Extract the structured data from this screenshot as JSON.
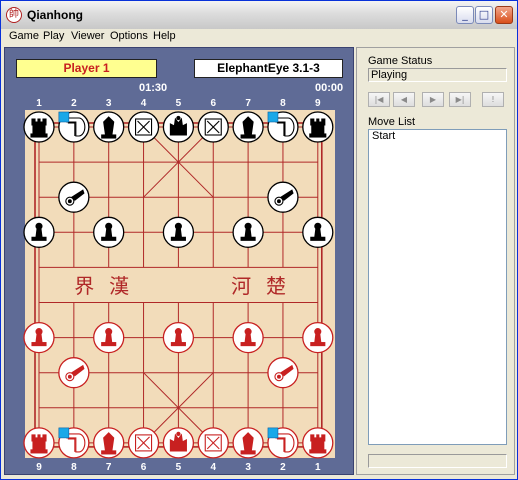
{
  "window": {
    "title": "Qianhong",
    "icon": "qianhong-app-icon",
    "icon_glyph": "帥",
    "controls": [
      "minimize-icon",
      "maximize-icon",
      "close-icon"
    ]
  },
  "menu": [
    "Game",
    "Play",
    "Viewer",
    "Options",
    "Help"
  ],
  "players": {
    "red": {
      "name": "Player 1",
      "time": "01:30"
    },
    "black": {
      "name": "ElephantEye 3.1-3",
      "time": "00:00"
    }
  },
  "board": {
    "file_labels_top": [
      "1",
      "2",
      "3",
      "4",
      "5",
      "6",
      "7",
      "8",
      "9"
    ],
    "file_labels_bottom": [
      "9",
      "8",
      "7",
      "6",
      "5",
      "4",
      "3",
      "2",
      "1"
    ],
    "river_left": [
      "界",
      "漢"
    ],
    "river_right": [
      "河",
      "楚"
    ],
    "colors": {
      "board": "#F2DCBA",
      "lines": "#B02828",
      "red_piece": "#C82020",
      "black_piece": "#000000",
      "frame": "#5F6B96",
      "highlight": "#1AA8E8"
    },
    "pieces": [
      {
        "side": "black",
        "type": "chariot",
        "file": 0,
        "rank": 0
      },
      {
        "side": "black",
        "type": "horse",
        "file": 1,
        "rank": 0
      },
      {
        "side": "black",
        "type": "elephant",
        "file": 2,
        "rank": 0
      },
      {
        "side": "black",
        "type": "advisor",
        "file": 3,
        "rank": 0
      },
      {
        "side": "black",
        "type": "general",
        "file": 4,
        "rank": 0
      },
      {
        "side": "black",
        "type": "advisor",
        "file": 5,
        "rank": 0
      },
      {
        "side": "black",
        "type": "elephant",
        "file": 6,
        "rank": 0
      },
      {
        "side": "black",
        "type": "horse",
        "file": 7,
        "rank": 0
      },
      {
        "side": "black",
        "type": "chariot",
        "file": 8,
        "rank": 0
      },
      {
        "side": "black",
        "type": "cannon",
        "file": 1,
        "rank": 2
      },
      {
        "side": "black",
        "type": "cannon",
        "file": 7,
        "rank": 2
      },
      {
        "side": "black",
        "type": "soldier",
        "file": 0,
        "rank": 3
      },
      {
        "side": "black",
        "type": "soldier",
        "file": 2,
        "rank": 3
      },
      {
        "side": "black",
        "type": "soldier",
        "file": 4,
        "rank": 3
      },
      {
        "side": "black",
        "type": "soldier",
        "file": 6,
        "rank": 3
      },
      {
        "side": "black",
        "type": "soldier",
        "file": 8,
        "rank": 3
      },
      {
        "side": "red",
        "type": "soldier",
        "file": 0,
        "rank": 6
      },
      {
        "side": "red",
        "type": "soldier",
        "file": 2,
        "rank": 6
      },
      {
        "side": "red",
        "type": "soldier",
        "file": 4,
        "rank": 6
      },
      {
        "side": "red",
        "type": "soldier",
        "file": 6,
        "rank": 6
      },
      {
        "side": "red",
        "type": "soldier",
        "file": 8,
        "rank": 6
      },
      {
        "side": "red",
        "type": "cannon",
        "file": 1,
        "rank": 7
      },
      {
        "side": "red",
        "type": "cannon",
        "file": 7,
        "rank": 7
      },
      {
        "side": "red",
        "type": "chariot",
        "file": 0,
        "rank": 9
      },
      {
        "side": "red",
        "type": "horse",
        "file": 1,
        "rank": 9
      },
      {
        "side": "red",
        "type": "elephant",
        "file": 2,
        "rank": 9
      },
      {
        "side": "red",
        "type": "advisor",
        "file": 3,
        "rank": 9
      },
      {
        "side": "red",
        "type": "general",
        "file": 4,
        "rank": 9
      },
      {
        "side": "red",
        "type": "advisor",
        "file": 5,
        "rank": 9
      },
      {
        "side": "red",
        "type": "elephant",
        "file": 6,
        "rank": 9
      },
      {
        "side": "red",
        "type": "horse",
        "file": 7,
        "rank": 9
      },
      {
        "side": "red",
        "type": "chariot",
        "file": 8,
        "rank": 9
      }
    ]
  },
  "side": {
    "game_status_label": "Game Status",
    "game_status_value": "Playing",
    "nav_buttons": [
      {
        "name": "first-move-icon",
        "glyph": "|◀"
      },
      {
        "name": "previous-move-icon",
        "glyph": "◀"
      },
      {
        "name": "next-move-icon",
        "glyph": "▶"
      },
      {
        "name": "last-move-icon",
        "glyph": "▶|"
      },
      {
        "name": "hint-icon",
        "glyph": "!"
      }
    ],
    "move_list_label": "Move List",
    "moves": [
      "Start"
    ]
  }
}
